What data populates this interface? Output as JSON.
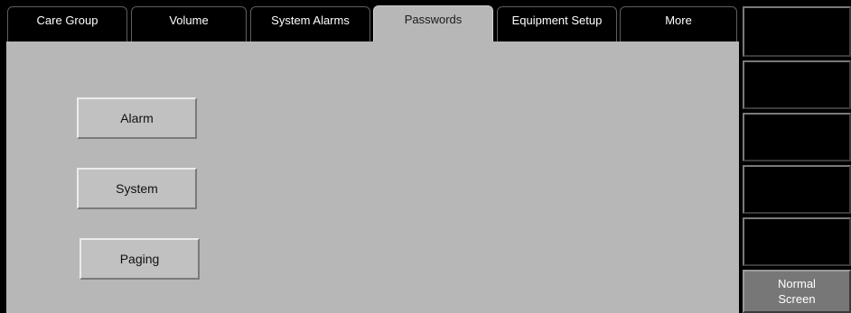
{
  "tabs": [
    {
      "label": "Care Group",
      "active": false
    },
    {
      "label": "Volume",
      "active": false
    },
    {
      "label": "System Alarms",
      "active": false
    },
    {
      "label": "Passwords",
      "active": true
    },
    {
      "label": "Equipment Setup",
      "active": false
    },
    {
      "label": "More",
      "active": false
    }
  ],
  "passwords": {
    "alarm_label": "Alarm",
    "system_label": "System",
    "paging_label": "Paging"
  },
  "side_panel": {
    "normal_screen_line1": "Normal",
    "normal_screen_line2": "Screen"
  },
  "colors": {
    "background": "#000000",
    "panel": "#b7b7b7",
    "button": "#c1c1c1",
    "normal_screen": "#777777"
  }
}
